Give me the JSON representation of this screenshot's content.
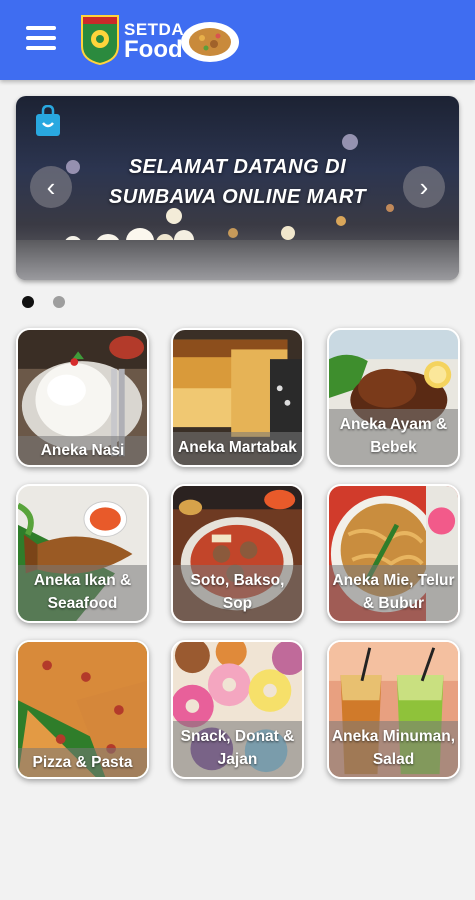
{
  "header": {
    "logo_line1": "SETDA",
    "logo_line2": "Food",
    "brand_color": "#3f6df1",
    "menu_icon": "hamburger-menu-icon"
  },
  "banner": {
    "text_line1": "SELAMAT DATANG DI",
    "text_line2": "SUMBAWA ONLINE MART",
    "bag_icon": "shopping-bag-icon",
    "prev_icon": "chevron-left-icon",
    "next_icon": "chevron-right-icon",
    "slide_count": 2,
    "active_slide": 1
  },
  "categories": [
    {
      "label": "Aneka Nasi"
    },
    {
      "label": "Aneka Martabak"
    },
    {
      "label": "Aneka Ayam & Bebek"
    },
    {
      "label": "Aneka Ikan & Seaafood"
    },
    {
      "label": "Soto, Bakso, Sop"
    },
    {
      "label": "Aneka Mie, Telur & Bubur"
    },
    {
      "label": "Pizza & Pasta"
    },
    {
      "label": "Snack, Donat & Jajan"
    },
    {
      "label": "Aneka Minuman, Salad"
    }
  ]
}
